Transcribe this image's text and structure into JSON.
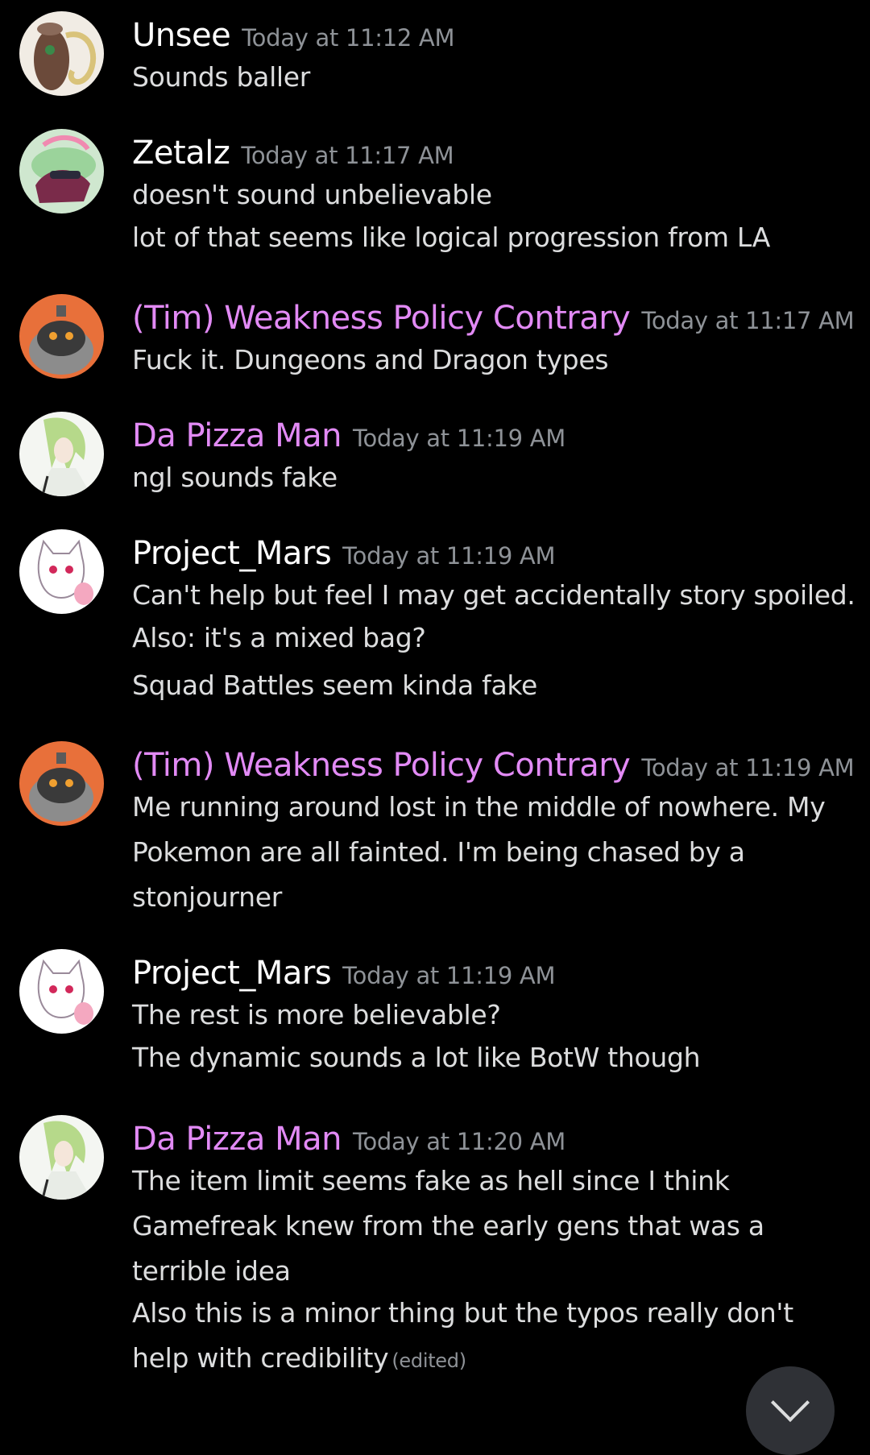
{
  "colors": {
    "background": "#000000",
    "username_default": "#ffffff",
    "username_role": "#e28af5",
    "timestamp": "#8e9297",
    "message_text": "#dcddde"
  },
  "messages": [
    {
      "avatar_icon": "pokemon-trunk-avatar-icon",
      "username": "Unsee",
      "username_color": "#ffffff",
      "timestamp": "Today at 11:12 AM",
      "lines": [
        "Sounds baller"
      ]
    },
    {
      "avatar_icon": "tentacle-creature-avatar-icon",
      "username": "Zetalz",
      "username_color": "#ffffff",
      "timestamp": "Today at 11:17 AM",
      "lines": [
        "doesn't sound unbelievable",
        "lot of that seems like logical progression from LA"
      ]
    },
    {
      "avatar_icon": "pumpkin-pokemon-avatar-icon",
      "username": "(Tim) Weakness Policy Contrary",
      "username_color": "#e28af5",
      "timestamp": "Today at 11:17 AM",
      "lines": [
        "Fuck it. Dungeons and Dragon types"
      ]
    },
    {
      "avatar_icon": "green-haired-character-avatar-icon",
      "username": "Da Pizza Man",
      "username_color": "#e28af5",
      "timestamp": "Today at 11:19 AM",
      "lines": [
        "ngl sounds fake"
      ]
    },
    {
      "avatar_icon": "white-cat-creature-avatar-icon",
      "username": "Project_Mars",
      "username_color": "#ffffff",
      "timestamp": "Today at 11:19 AM",
      "lines": [
        "Can't help but feel I may get accidentally story spoiled.",
        "Also: it's a mixed bag?",
        "Squad Battles seem kinda fake"
      ]
    },
    {
      "avatar_icon": "pumpkin-pokemon-avatar-icon",
      "username": "(Tim) Weakness Policy Contrary",
      "username_color": "#e28af5",
      "timestamp": "Today at 11:19 AM",
      "lines": [
        "Me running around lost in the middle of nowhere. My",
        "Pokemon are all fainted. I'm being chased by a",
        "stonjourner"
      ]
    },
    {
      "avatar_icon": "white-cat-creature-avatar-icon",
      "username": "Project_Mars",
      "username_color": "#ffffff",
      "timestamp": "Today at 11:19 AM",
      "lines": [
        "The rest is more believable?",
        "The dynamic sounds a lot like BotW though"
      ]
    },
    {
      "avatar_icon": "green-haired-character-avatar-icon",
      "username": "Da Pizza Man",
      "username_color": "#e28af5",
      "timestamp": "Today at 11:20 AM",
      "lines": [
        "The item limit seems fake as hell since I think",
        "Gamefreak knew from the early gens that was a",
        "terrible idea",
        "Also this is a minor thing but the typos really don't",
        "help with credibility"
      ],
      "edited_label": "(edited)"
    }
  ],
  "jump_button": {
    "icon": "chevron-down-icon"
  }
}
